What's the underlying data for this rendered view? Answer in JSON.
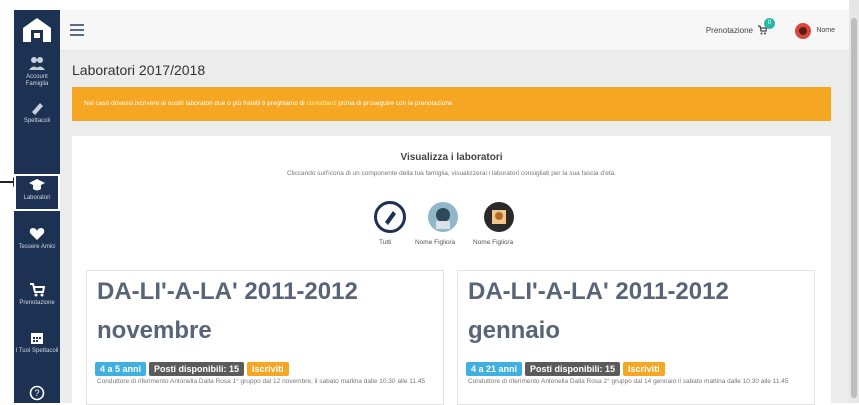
{
  "sidebar": {
    "items": [
      {
        "label": "Account Famiglia",
        "icon": "users-icon"
      },
      {
        "label": "Spettacoli",
        "icon": "ticket-icon"
      },
      {
        "label": "Laboratori",
        "icon": "graduation-cap-icon"
      },
      {
        "label": "Tessere Amici",
        "icon": "heart-icon"
      },
      {
        "label": "Prenotazione",
        "icon": "cart-icon"
      },
      {
        "label": "I Tuoi Spettacoli",
        "icon": "calendar-icon"
      },
      {
        "label": "",
        "icon": "help-icon"
      }
    ]
  },
  "header": {
    "prenotazione_label": "Prenotazione",
    "cart_count": "0",
    "user_name": "Nome"
  },
  "main": {
    "title": "Laboratori 2017/2018",
    "alert": {
      "text_before": "Nel caso dovessi iscrivere ai nostri laboratori due o più fratelli ti preghiamo di ",
      "link": "contattarci",
      "text_after": " prima di proseguire con la prenotazione"
    },
    "panel": {
      "title": "Visualizza i laboratori",
      "subtitle": "Cliccando sull'icona di un componente della tua famiglia, visualizzerai i laboratori consigliati per la sua fascia d'età.",
      "filters": [
        {
          "label": "Tutti"
        },
        {
          "label": "Nome Figlio/a"
        },
        {
          "label": "Nome Figlio/a"
        }
      ]
    },
    "cards": [
      {
        "title": "DA-LI'-A-LA' 2011-2012",
        "month": "novembre",
        "age": "4 a 5 anni",
        "seats": "Posti disponibili: 15",
        "action": "Iscriviti",
        "desc": "Conduttore di riferimento Antonella Dalla Rosa 1° gruppo dal 12 novembre, il sabato mattina dalle 10.30 alle 11.45"
      },
      {
        "title": "DA-LI'-A-LA' 2011-2012",
        "month": "gennaio",
        "age": "4 a 21 anni",
        "seats": "Posti disponibili: 15",
        "action": "Iscriviti",
        "desc": "Conduttore di riferimento Antonella Dalla Rosa 2° gruppo dal 14 gennaio il sabato mattina dalle 10.30 alle 11.45"
      }
    ]
  },
  "colors": {
    "sidebar_bg": "#1d3152",
    "alert_bg": "#f5a623",
    "age_tag": "#3fb0df",
    "seats_tag": "#5b5b5b",
    "action_tag": "#f5a623"
  }
}
